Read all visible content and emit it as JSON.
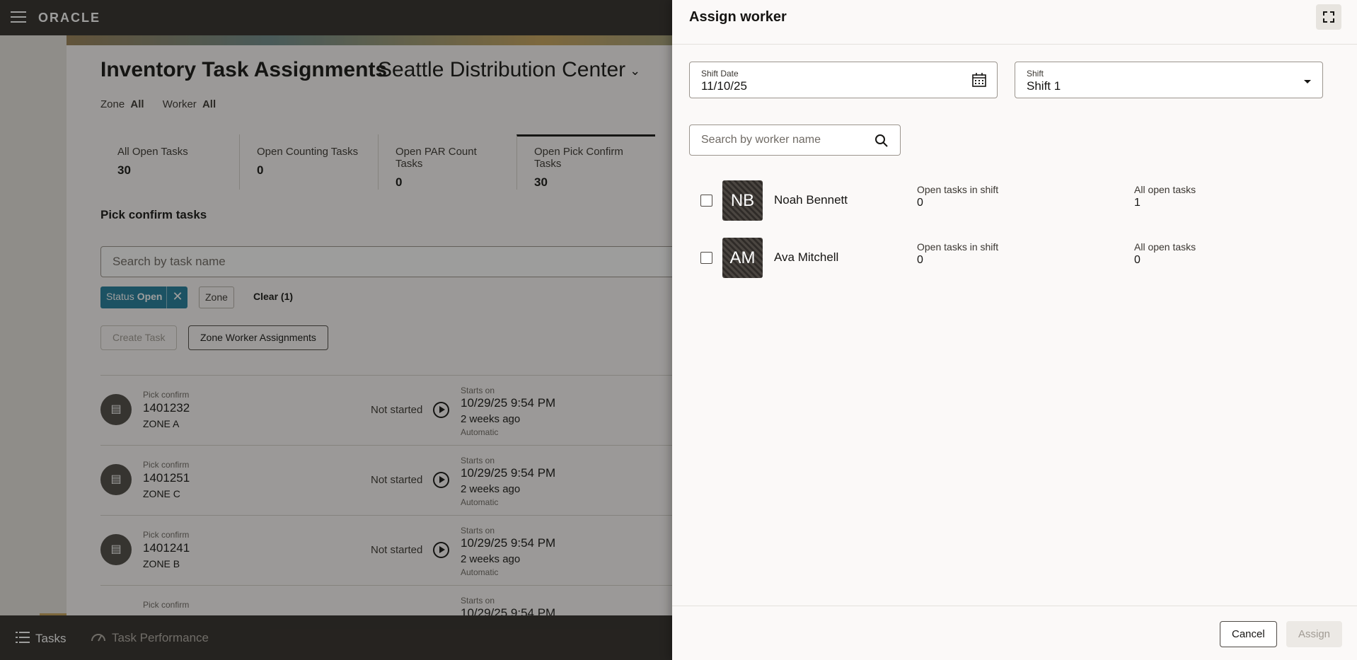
{
  "app": {
    "brand": "ORACLE"
  },
  "page": {
    "title": "Inventory Task Assignments",
    "location": "Seattle Distribution Center",
    "filters": {
      "zone_label": "Zone",
      "zone_value": "All",
      "worker_label": "Worker",
      "worker_value": "All"
    },
    "metrics": [
      {
        "label": "All Open Tasks",
        "value": "30"
      },
      {
        "label": "Open Counting Tasks",
        "value": "0"
      },
      {
        "label": "Open PAR Count Tasks",
        "value": "0"
      },
      {
        "label": "Open Pick Confirm Tasks",
        "value": "30"
      }
    ],
    "section_title": "Pick confirm tasks",
    "task_search_placeholder": "Search by task name",
    "chips": {
      "status_label": "Status",
      "status_value": "Open",
      "zone": "Zone",
      "clear": "Clear (1)"
    },
    "buttons": {
      "create_task": "Create Task",
      "zone_worker_assignments": "Zone Worker Assignments"
    },
    "tasks": [
      {
        "type": "Pick confirm",
        "id": "1401232",
        "zone": "ZONE A",
        "status": "Not started",
        "starts_label": "Starts on",
        "starts": "10/29/25 9:54 PM",
        "ago": "2 weeks ago",
        "mode": "Automatic"
      },
      {
        "type": "Pick confirm",
        "id": "1401251",
        "zone": "ZONE C",
        "status": "Not started",
        "starts_label": "Starts on",
        "starts": "10/29/25 9:54 PM",
        "ago": "2 weeks ago",
        "mode": "Automatic"
      },
      {
        "type": "Pick confirm",
        "id": "1401241",
        "zone": "ZONE B",
        "status": "Not started",
        "starts_label": "Starts on",
        "starts": "10/29/25 9:54 PM",
        "ago": "2 weeks ago",
        "mode": "Automatic"
      },
      {
        "type": "Pick confirm",
        "id": "",
        "zone": "",
        "status": "",
        "starts_label": "Starts on",
        "starts": "10/29/25 9:54 PM",
        "ago": "",
        "mode": ""
      }
    ]
  },
  "bottom_nav": {
    "tasks": "Tasks",
    "performance": "Task Performance"
  },
  "drawer": {
    "title": "Assign worker",
    "shift_date_label": "Shift Date",
    "shift_date_value": "11/10/25",
    "shift_label": "Shift",
    "shift_value": "Shift 1",
    "search_placeholder": "Search by worker name",
    "workers": [
      {
        "initials": "NB",
        "name": "Noah Bennett",
        "open_shift_label": "Open tasks in shift",
        "open_shift": "0",
        "all_open_label": "All open tasks",
        "all_open": "1"
      },
      {
        "initials": "AM",
        "name": "Ava Mitchell",
        "open_shift_label": "Open tasks in shift",
        "open_shift": "0",
        "all_open_label": "All open tasks",
        "all_open": "0"
      }
    ],
    "cancel": "Cancel",
    "assign": "Assign"
  },
  "colors": {
    "accent": "#227e9e",
    "dark_bar": "#312d2a"
  }
}
